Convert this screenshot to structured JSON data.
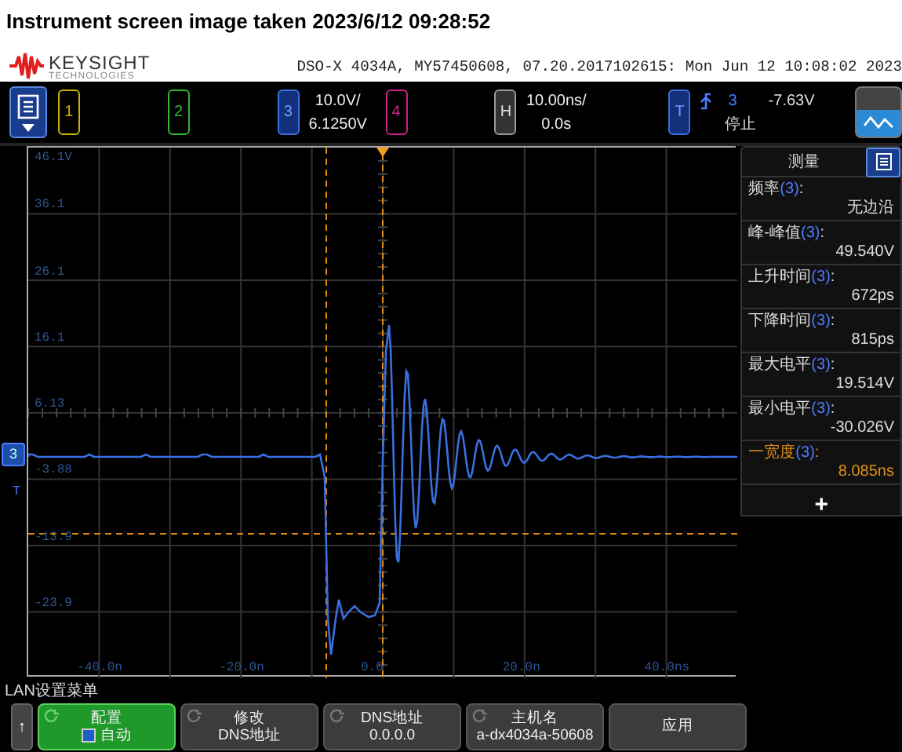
{
  "caption": "Instrument screen image taken 2023/6/12 09:28:52",
  "brand": {
    "name": "KEYSIGHT",
    "subtitle": "TECHNOLOGIES"
  },
  "instrument_info": "DSO-X 4034A, MY57450608, 07.20.2017102615: Mon Jun 12 10:08:02 2023",
  "channels": [
    {
      "label": "1",
      "color": "#c8b400",
      "on": false
    },
    {
      "label": "2",
      "color": "#2fb82f",
      "on": false
    },
    {
      "label": "3",
      "color": "#3a6fe0",
      "on": true,
      "scale": "10.0V/",
      "offset": "6.1250V"
    },
    {
      "label": "4",
      "color": "#d0208a",
      "on": false
    }
  ],
  "horizontal": {
    "label": "H",
    "scale": "10.00ns/",
    "delay": "0.0s"
  },
  "trigger": {
    "label": "T",
    "source": "3",
    "level": "-7.63V",
    "status": "停止"
  },
  "graticule": {
    "y_labels": [
      "46.1V",
      "36.1",
      "26.1",
      "16.1",
      "6.13",
      "-3.88",
      "-13.9",
      "-23.9"
    ],
    "x_labels": [
      "-40.0n",
      "-20.0n",
      "0.0",
      "20.0n",
      "40.0ns"
    ]
  },
  "channel_marker": "3",
  "trigger_marker": "T",
  "measurements_panel": {
    "title": "测量",
    "add": "+",
    "items": [
      {
        "name": "频率",
        "source": "(3)",
        "end": ":",
        "value": "无边沿",
        "selected": false
      },
      {
        "name": "峰-峰值",
        "source": "(3)",
        "end": ":",
        "value": "49.540V",
        "selected": false
      },
      {
        "name": "上升时间",
        "source": "(3)",
        "end": ":",
        "value": "672ps",
        "selected": false
      },
      {
        "name": "下降时间",
        "source": "(3)",
        "end": ":",
        "value": "815ps",
        "selected": false
      },
      {
        "name": "最大电平",
        "source": "(3)",
        "end": ":",
        "value": "19.514V",
        "selected": false
      },
      {
        "name": "最小电平",
        "source": "(3)",
        "end": ":",
        "value": "-30.026V",
        "selected": false
      },
      {
        "name": "一宽度",
        "source": "(3)",
        "end": ":",
        "value": "8.085ns",
        "selected": true
      }
    ]
  },
  "menu_title": "LAN设置菜单",
  "back_key": "↑",
  "softkeys": [
    {
      "kind": "checkbox",
      "title": "配置",
      "value": "自动",
      "checked": true,
      "selected": true
    },
    {
      "kind": "knob",
      "title": "修改",
      "value": "DNS地址",
      "selected": false
    },
    {
      "kind": "knob",
      "title": "DNS地址",
      "value": "0.0.0.0",
      "selected": false
    },
    {
      "kind": "knob",
      "title": "主机名",
      "value": "a-dx4034a-50608",
      "selected": false
    },
    {
      "kind": "plain",
      "title": "应用",
      "selected": false
    }
  ]
}
